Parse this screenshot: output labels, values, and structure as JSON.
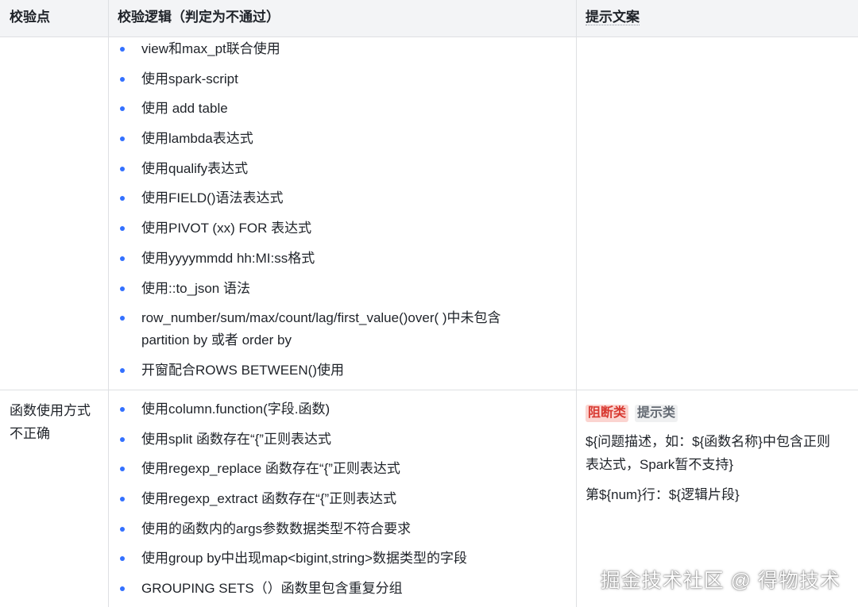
{
  "columns": [
    "校验点",
    "校验逻辑（判定为不通过）",
    "提示文案"
  ],
  "row1": {
    "checkpoint": "",
    "logic": [
      "view和max_pt联合使用",
      "使用spark-script",
      "使用 add table",
      "使用lambda表达式",
      "使用qualify表达式",
      "使用FIELD()语法表达式",
      "使用PIVOT (xx) FOR 表达式",
      "使用yyyymmdd hh:MI:ss格式",
      "使用::to_json 语法",
      "row_number/sum/max/count/lag/first_value()over(  )中未包含",
      "开窗配合ROWS BETWEEN()使用"
    ],
    "logic_item_10_line2": "partition by 或者 order by"
  },
  "row2": {
    "checkpoint_line1": "函数使用方式",
    "checkpoint_line2": "不正确",
    "logic": [
      "使用column.function(字段.函数)",
      "使用split 函数存在“{”正则表达式",
      "使用regexp_replace 函数存在“{”正则表达式",
      "使用regexp_extract 函数存在“{”正则表达式",
      "使用的函数内的args参数数据类型不符合要求",
      "使用group by中出现map<bigint,string>数据类型的字段",
      "GROUPING SETS（）函数里包含重复分组"
    ],
    "badges": {
      "block": "阻断类",
      "hint": "提示类"
    },
    "message_line1": "${问题描述，如：${函数名称}中包含正则",
    "message_line2": "表达式，Spark暂不支持}",
    "message_line3": "第${num}行：${逻辑片段}"
  },
  "watermark": "掘金技术社区 @ 得物技术",
  "colors": {
    "bullet": "#3370ff",
    "header_bg": "#f3f4f6",
    "border": "#dee0e3",
    "badge_red_bg": "#fbd4d0",
    "badge_red_text": "#d83931"
  }
}
